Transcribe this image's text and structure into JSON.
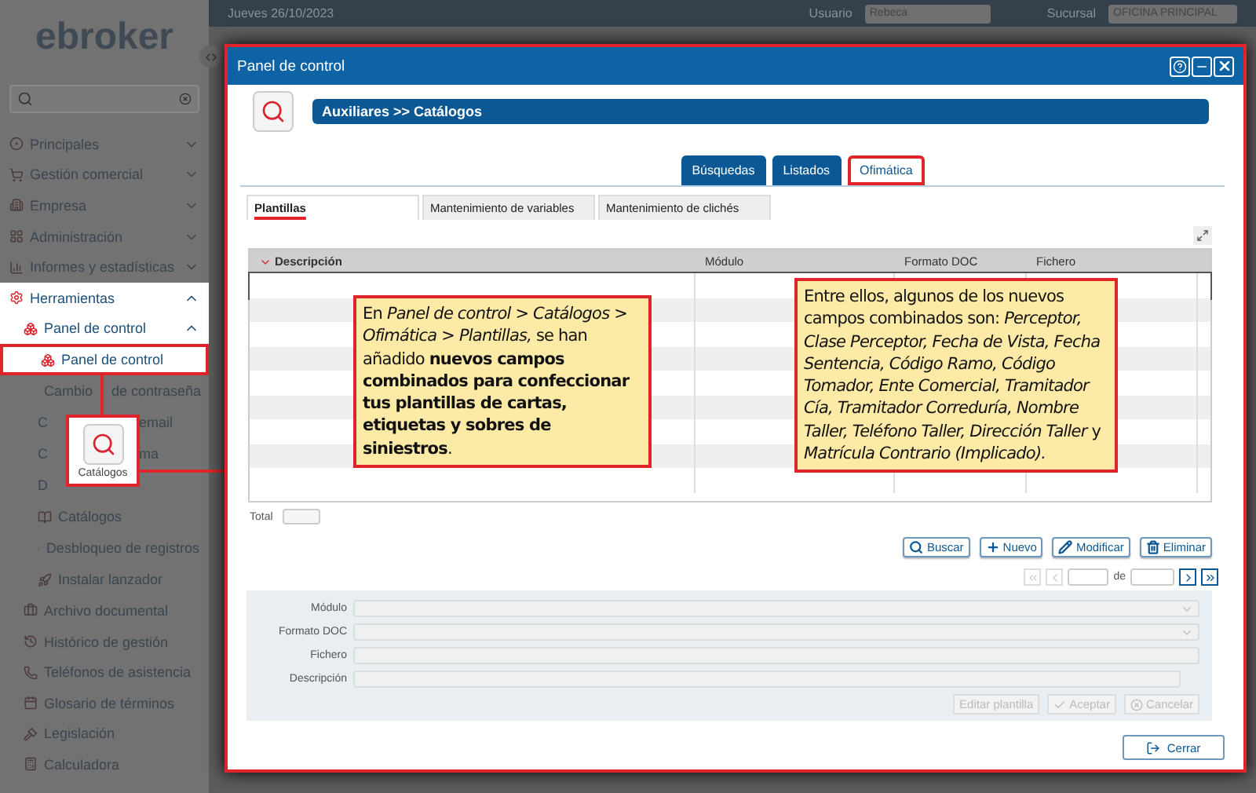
{
  "logo": "ebroker",
  "topbar": {
    "date": "Jueves 26/10/2023",
    "user_label": "Usuario",
    "user": "Rebeca",
    "branch_label": "Sucursal",
    "branch": "OFICINA PRINCIPAL"
  },
  "sidebar": {
    "items": [
      {
        "label": "Principales",
        "expanded": false,
        "selected": false
      },
      {
        "label": "Gestión comercial",
        "expanded": false,
        "selected": false
      },
      {
        "label": "Empresa",
        "expanded": false,
        "selected": false
      },
      {
        "label": "Administración",
        "expanded": false,
        "selected": false
      },
      {
        "label": "Informes y estadísticas",
        "expanded": false,
        "selected": false
      },
      {
        "label": "Herramientas",
        "expanded": true,
        "selected": false,
        "children": [
          {
            "label": "Panel de control",
            "expanded": true,
            "selected": false,
            "children": [
              {
                "label": "Panel de control",
                "selected": true
              },
              {
                "label": "Cambio",
                "label_end": "de contraseña",
                "selected": false
              },
              {
                "label": "C",
                "label_end": "email",
                "selected": false
              },
              {
                "label": "C",
                "label_end": "ma",
                "selected": false
              },
              {
                "label": "D",
                "selected": false
              },
              {
                "label": "Catálogos",
                "selected": false
              },
              {
                "label": "Desbloqueo de registros",
                "selected": false
              },
              {
                "label": "Instalar lanzador",
                "selected": false
              }
            ]
          },
          {
            "label": "Archivo documental",
            "selected": false
          },
          {
            "label": "Histórico de gestión",
            "selected": false
          },
          {
            "label": "Teléfonos de asistencia",
            "selected": false
          },
          {
            "label": "Glosario de términos",
            "selected": false
          },
          {
            "label": "Legislación",
            "selected": false
          },
          {
            "label": "Calculadora",
            "selected": false
          }
        ]
      }
    ]
  },
  "sidebar_callout": {
    "label": "Catálogos"
  },
  "dialog": {
    "title": "Panel de control",
    "breadcrumb": "Auxiliares >> Catálogos",
    "tabs": [
      {
        "label": "Búsquedas",
        "selected": false
      },
      {
        "label": "Listados",
        "selected": false
      },
      {
        "label": "Ofimática",
        "selected": true
      }
    ],
    "subtabs": [
      {
        "label": "Plantillas",
        "selected": true
      },
      {
        "label": "Mantenimiento de variables",
        "selected": false
      },
      {
        "label": "Mantenimiento de clichés",
        "selected": false
      }
    ],
    "table": {
      "columns": [
        "Descripción",
        "Módulo",
        "Formato DOC",
        "Fichero"
      ]
    },
    "total_label": "Total",
    "actions": [
      "Buscar",
      "Nuevo",
      "Modificar",
      "Eliminar"
    ],
    "pager": {
      "of": "de"
    },
    "form": {
      "fields": [
        {
          "label": "Módulo",
          "kind": "select"
        },
        {
          "label": "Formato DOC",
          "kind": "select"
        },
        {
          "label": "Fichero",
          "kind": "input"
        },
        {
          "label": "Descripción",
          "kind": "input"
        }
      ],
      "buttons": [
        {
          "label": "Editar plantilla",
          "disabled": true
        },
        {
          "label": "Aceptar",
          "disabled": true
        },
        {
          "label": "Cancelar",
          "disabled": true
        }
      ]
    },
    "close": "Cerrar"
  },
  "callouts": [
    "En *Panel de control > Catálogos > Ofimática > Plantillas,* se han añadido **nuevos campos combinados para confeccionar tus plantillas de cartas, etiquetas y sobres de siniestros**.",
    "Entre ellos, algunos de los nuevos campos combinados son: *Perceptor, Clase Perceptor, Fecha de Vista, Fecha Sentencia, Código Ramo, Código Tomador, Ente Comercial, Tramitador Cía, Tramitador Correduría, Nombre Taller, Teléfono Taller, Dirección Taller* y *Matrícula Contrario (Implicado).*"
  ]
}
